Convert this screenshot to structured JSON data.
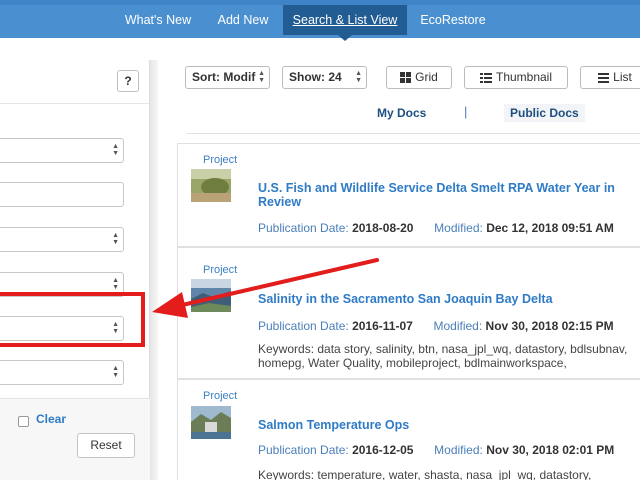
{
  "nav": {
    "items": [
      {
        "label": "What's New"
      },
      {
        "label": "Add New"
      },
      {
        "label": "Search & List View"
      },
      {
        "label": "EcoRestore"
      }
    ],
    "active_index": 2,
    "accent": "#4a8fd0",
    "active_color": "#215c92"
  },
  "filter_panel": {
    "help_label": "?",
    "clear_label": "Clear",
    "reset_label": "Reset"
  },
  "toolbar": {
    "sort_value": "Sort: Modif",
    "show_value": "Show: 24",
    "grid_label": "Grid",
    "thumbnail_label": "Thumbnail",
    "list_label": "List"
  },
  "docs_tabs": {
    "my_docs": "My Docs",
    "divider": "|",
    "public_docs": "Public Docs"
  },
  "results": [
    {
      "type": "Project",
      "title": "U.S. Fish and Wildlife Service Delta Smelt RPA Water Year in Review",
      "pub_label": "Publication Date:",
      "pub_value": "2018-08-20",
      "mod_label": "Modified:",
      "mod_value": "Dec 12, 2018 09:51 AM",
      "keywords": ""
    },
    {
      "type": "Project",
      "title": "Salinity in the Sacramento San Joaquin Bay Delta",
      "pub_label": "Publication Date:",
      "pub_value": "2016-11-07",
      "mod_label": "Modified:",
      "mod_value": "Nov 30, 2018 02:15 PM",
      "keywords": "Keywords: data story, salinity, btn, nasa_jpl_wq, datastory, bdlsubnav, homepg, Water Quality, mobileproject, bdlmainworkspace,"
    },
    {
      "type": "Project",
      "title": "Salmon Temperature Ops",
      "pub_label": "Publication Date:",
      "pub_value": "2016-12-05",
      "mod_label": "Modified:",
      "mod_value": "Nov 30, 2018 02:01 PM",
      "keywords": "Keywords: temperature, water, shasta, nasa_jpl_wq, datastory,"
    }
  ],
  "colors": {
    "link": "#2f7bc5",
    "annotation_red": "#e31c1c"
  }
}
